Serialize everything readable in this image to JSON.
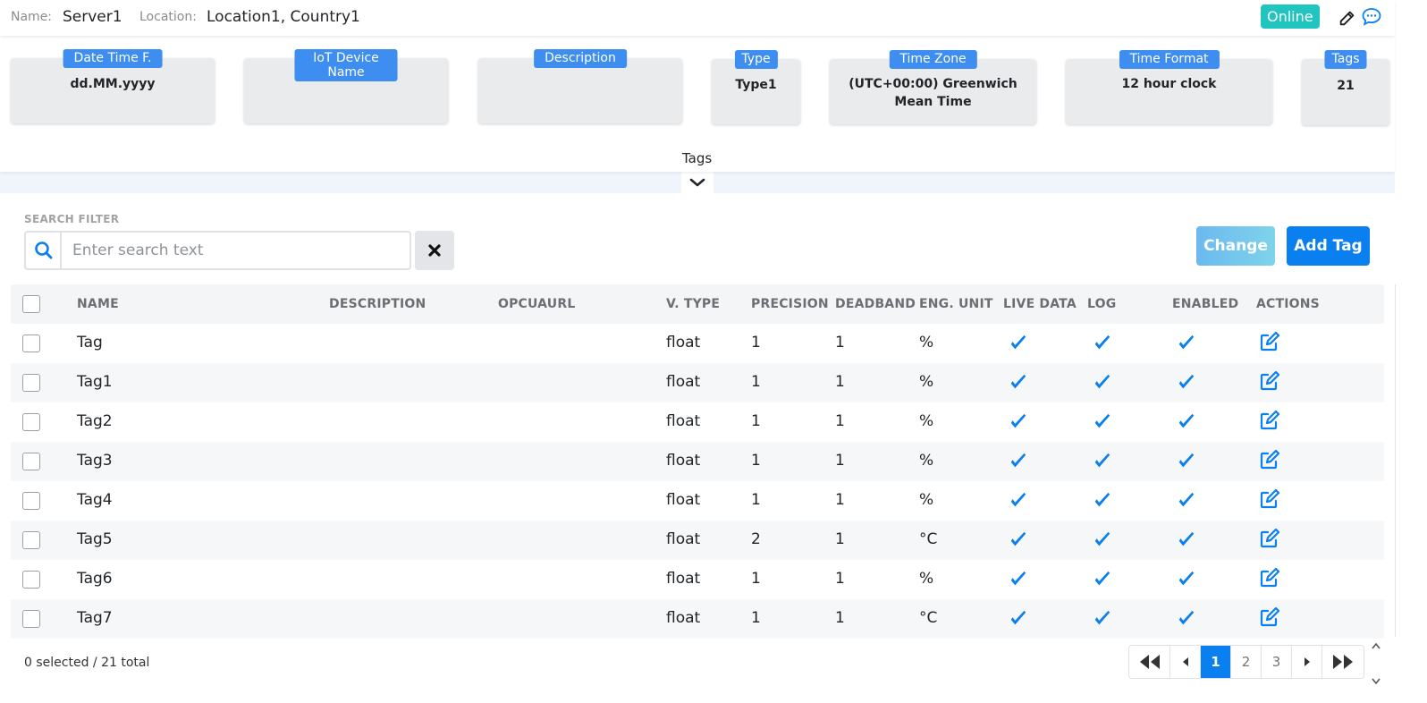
{
  "header": {
    "name_label": "Name:",
    "name_value": "Server1",
    "location_label": "Location:",
    "location_value": "Location1, Country1",
    "status": "Online",
    "status_color": "#21c5bf",
    "icons": [
      "edit-icon",
      "comment-icon"
    ]
  },
  "info_cards": [
    {
      "title": "Date Time F.",
      "value": "dd.MM.yyyy"
    },
    {
      "title": "IoT Device Name",
      "value": ""
    },
    {
      "title": "Description",
      "value": ""
    },
    {
      "title": "Type",
      "value": "Type1"
    },
    {
      "title": "Time Zone",
      "value": "(UTC+00:00) Greenwich Mean Time"
    },
    {
      "title": "Time Format",
      "value": "12 hour clock"
    },
    {
      "title": "Tags",
      "value": "21"
    }
  ],
  "tags_toggle": {
    "label": "Tags",
    "icon": "chevron-down-icon"
  },
  "search": {
    "label": "SEARCH FILTER",
    "placeholder": "Enter search text",
    "value": ""
  },
  "actions": {
    "change_label": "Change",
    "add_tag_label": "Add Tag"
  },
  "table": {
    "columns": [
      "NAME",
      "DESCRIPTION",
      "OPCUAURL",
      "V. TYPE",
      "PRECISION",
      "DEADBAND",
      "ENG. UNIT",
      "LIVE DATA",
      "LOG",
      "ENABLED",
      "ACTIONS"
    ],
    "rows": [
      {
        "name": "Tag",
        "description": "",
        "opcuaurl": "",
        "vtype": "float",
        "precision": "1",
        "deadband": "1",
        "unit": "%",
        "live_data": true,
        "log": true,
        "enabled": true
      },
      {
        "name": "Tag1",
        "description": "",
        "opcuaurl": "",
        "vtype": "float",
        "precision": "1",
        "deadband": "1",
        "unit": "%",
        "live_data": true,
        "log": true,
        "enabled": true
      },
      {
        "name": "Tag2",
        "description": "",
        "opcuaurl": "",
        "vtype": "float",
        "precision": "1",
        "deadband": "1",
        "unit": "%",
        "live_data": true,
        "log": true,
        "enabled": true
      },
      {
        "name": "Tag3",
        "description": "",
        "opcuaurl": "",
        "vtype": "float",
        "precision": "1",
        "deadband": "1",
        "unit": "%",
        "live_data": true,
        "log": true,
        "enabled": true
      },
      {
        "name": "Tag4",
        "description": "",
        "opcuaurl": "",
        "vtype": "float",
        "precision": "1",
        "deadband": "1",
        "unit": "%",
        "live_data": true,
        "log": true,
        "enabled": true
      },
      {
        "name": "Tag5",
        "description": "",
        "opcuaurl": "",
        "vtype": "float",
        "precision": "2",
        "deadband": "1",
        "unit": "°C",
        "live_data": true,
        "log": true,
        "enabled": true
      },
      {
        "name": "Tag6",
        "description": "",
        "opcuaurl": "",
        "vtype": "float",
        "precision": "1",
        "deadband": "1",
        "unit": "%",
        "live_data": true,
        "log": true,
        "enabled": true
      },
      {
        "name": "Tag7",
        "description": "",
        "opcuaurl": "",
        "vtype": "float",
        "precision": "1",
        "deadband": "1",
        "unit": "°C",
        "live_data": true,
        "log": true,
        "enabled": true
      }
    ]
  },
  "footer": {
    "selection_summary": "0 selected / 21 total",
    "pages": [
      "1",
      "2",
      "3"
    ],
    "current_page": "1"
  },
  "colors": {
    "accent": "#0a7ff0",
    "card_tag": "#3d8ef0",
    "check": "#0a7ff0"
  }
}
